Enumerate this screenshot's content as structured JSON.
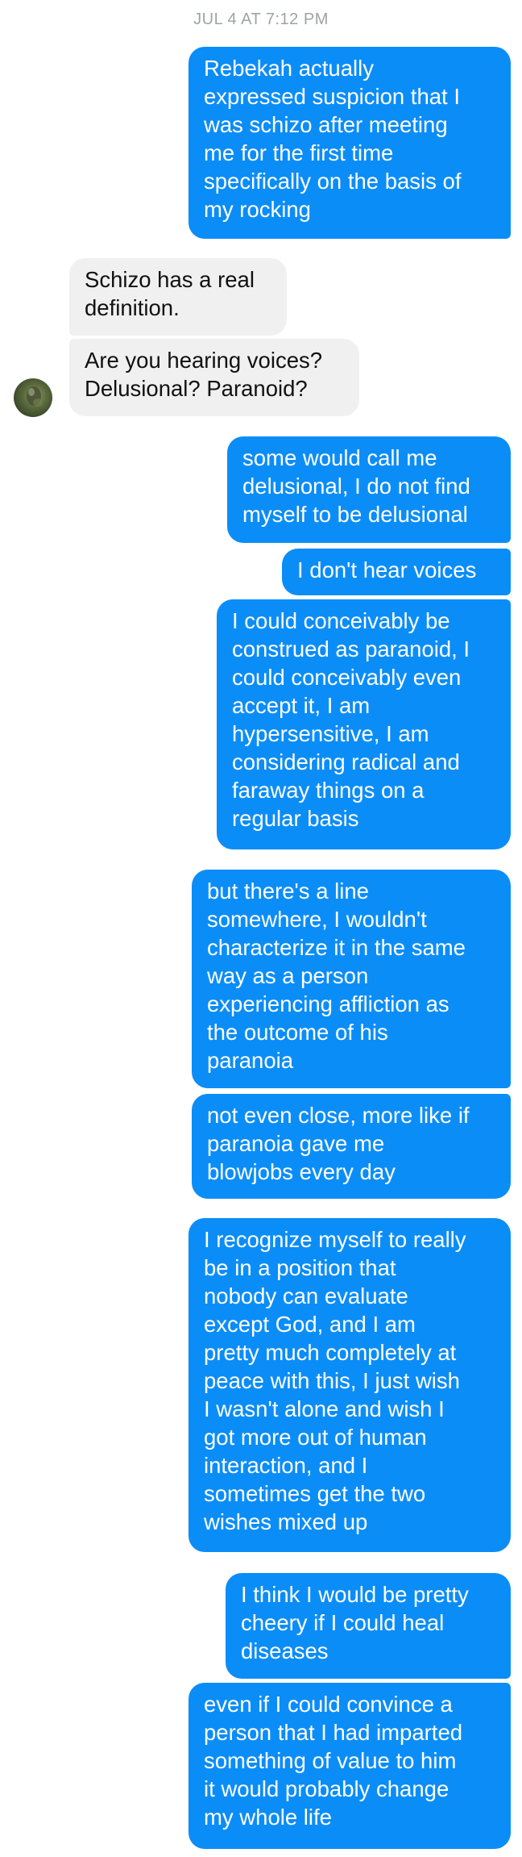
{
  "timestamp": "JUL 4 AT 7:12 PM",
  "messages": [
    {
      "id": "m1",
      "sender": "me",
      "text": "Rebekah actually\nexpressed suspicion that I\nwas schizo after meeting\nme for the first time\nspecifically on the basis of\nmy rocking"
    },
    {
      "id": "m2",
      "sender": "contact",
      "text": "Schizo has a real\ndefinition."
    },
    {
      "id": "m3",
      "sender": "contact",
      "text": "Are you hearing voices?\nDelusional? Paranoid?"
    },
    {
      "id": "m4",
      "sender": "me",
      "text": "some would call me\ndelusional, I do not find\nmyself to be delusional"
    },
    {
      "id": "m5",
      "sender": "me",
      "text": "I don't hear voices"
    },
    {
      "id": "m6",
      "sender": "me",
      "text": "I could conceivably be\nconstrued as paranoid, I\ncould conceivably even\naccept it, I am\nhypersensitive, I am\nconsidering radical and\nfaraway things on a\nregular basis"
    },
    {
      "id": "m7",
      "sender": "me",
      "text": "but there's a line\nsomewhere, I wouldn't\ncharacterize it in the same\nway as a person\nexperiencing affliction as\nthe outcome of his\nparanoia"
    },
    {
      "id": "m8",
      "sender": "me",
      "text": "not even close, more like if\nparanoia gave me\nblowjobs every day"
    },
    {
      "id": "m9",
      "sender": "me",
      "text": "I recognize myself to really\nbe in a position that\nnobody can evaluate\nexcept God, and I am\npretty much completely at\npeace with this, I just wish\nI wasn't alone and wish I\ngot more out of human\ninteraction, and I\nsometimes get the two\nwishes mixed up"
    },
    {
      "id": "m10",
      "sender": "me",
      "text": "I think I would be pretty\ncheery if I could heal\ndiseases"
    },
    {
      "id": "m11",
      "sender": "me",
      "text": "even if I could convince a\nperson that I had imparted\nsomething of value to him\nit would probably change\nmy whole life"
    }
  ],
  "colors": {
    "outgoing_bubble": "#0b8df8",
    "incoming_bubble": "#f0f0f0",
    "timestamp_text": "#9ea3a8"
  }
}
